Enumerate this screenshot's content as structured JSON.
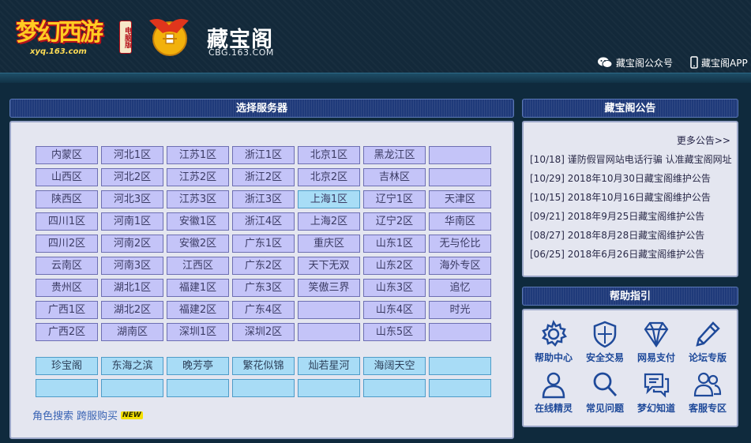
{
  "header": {
    "game_logo_text": "梦幻西游",
    "game_logo_edition": "电脑版",
    "game_logo_domain": "xyq.163.com",
    "cbg_name": "藏宝阁",
    "cbg_domain": "CBG.163.COM",
    "wechat_label": "藏宝阁公众号",
    "app_label": "藏宝阁APP"
  },
  "server_panel": {
    "title": "选择服务器",
    "rows": [
      [
        "内蒙区",
        "河北1区",
        "江苏1区",
        "浙江1区",
        "北京1区",
        "黑龙江区",
        ""
      ],
      [
        "山西区",
        "河北2区",
        "江苏2区",
        "浙江2区",
        "北京2区",
        "吉林区",
        ""
      ],
      [
        "陕西区",
        "河北3区",
        "江苏3区",
        "浙江3区",
        "上海1区",
        "辽宁1区",
        "天津区"
      ],
      [
        "四川1区",
        "河南1区",
        "安徽1区",
        "浙江4区",
        "上海2区",
        "辽宁2区",
        "华南区"
      ],
      [
        "四川2区",
        "河南2区",
        "安徽2区",
        "广东1区",
        "重庆区",
        "山东1区",
        "无与伦比"
      ],
      [
        "云南区",
        "河南3区",
        "江西区",
        "广东2区",
        "天下无双",
        "山东2区",
        "海外专区"
      ],
      [
        "贵州区",
        "湖北1区",
        "福建1区",
        "广东3区",
        "笑傲三界",
        "山东3区",
        "追忆"
      ],
      [
        "广西1区",
        "湖北2区",
        "福建2区",
        "广东4区",
        "",
        "山东4区",
        "时光"
      ],
      [
        "广西2区",
        "湖南区",
        "深圳1区",
        "深圳2区",
        "",
        "山东5区",
        ""
      ]
    ],
    "zone_rows": [
      [
        "珍宝阁",
        "东海之滨",
        "晚芳亭",
        "繁花似锦",
        "灿若星河",
        "海阔天空",
        ""
      ],
      [
        "",
        "",
        "",
        "",
        "",
        "",
        ""
      ]
    ],
    "link_role_search": "角色搜索",
    "link_cross_buy": "跨服购买",
    "new_badge": "NEW"
  },
  "notice_panel": {
    "title": "藏宝阁公告",
    "more_label": "更多公告>>",
    "items": [
      "[10/18] 谨防假冒网站电话行骗 认准藏宝阁网址",
      "[10/29] 2018年10月30日藏宝阁维护公告",
      "[10/15] 2018年10月16日藏宝阁维护公告",
      "[09/21] 2018年9月25日藏宝阁维护公告",
      "[08/27] 2018年8月28日藏宝阁维护公告",
      "[06/25] 2018年6月26日藏宝阁维护公告"
    ]
  },
  "help_panel": {
    "title": "帮助指引",
    "items": [
      {
        "label": "帮助中心",
        "icon": "gear-icon"
      },
      {
        "label": "安全交易",
        "icon": "shield-icon"
      },
      {
        "label": "网易支付",
        "icon": "diamond-icon"
      },
      {
        "label": "论坛专版",
        "icon": "pencil-icon"
      },
      {
        "label": "在线精灵",
        "icon": "user-icon"
      },
      {
        "label": "常见问题",
        "icon": "magnifier-icon"
      },
      {
        "label": "梦幻知道",
        "icon": "chat-icon"
      },
      {
        "label": "客服专区",
        "icon": "group-icon"
      }
    ]
  },
  "colors": {
    "header_bg": "#13293a",
    "panel_head": "#1f3a7a",
    "panel_body": "#e4e6f0",
    "server_btn": "#c4c4f8",
    "server_btn_highlight": "#a8ddf6",
    "zone_btn": "#a8dcf6",
    "link": "#3a64b4",
    "help_icon": "#1f4a9a"
  }
}
